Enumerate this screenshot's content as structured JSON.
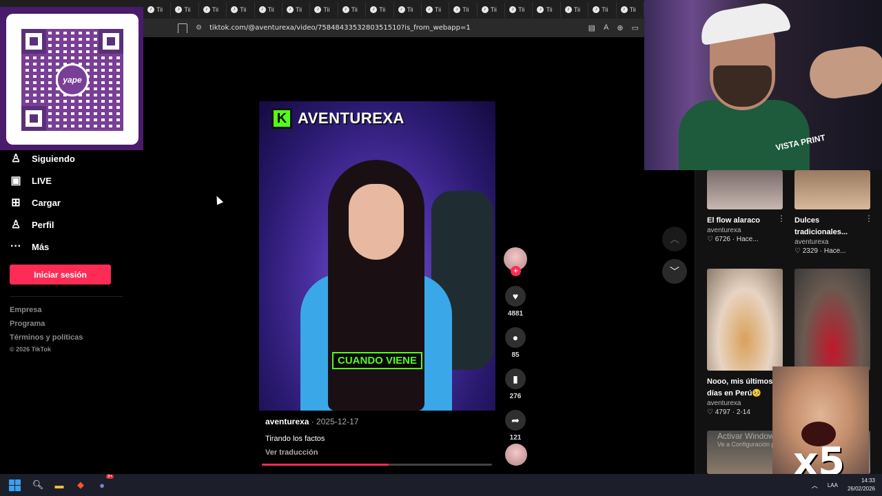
{
  "browser": {
    "url": "tiktok.com/@aventurexa/video/7584843353280351510?is_from_webapp=1",
    "tab_label": "Tii",
    "tab_count": 18
  },
  "overlay": {
    "qr_label": "yape"
  },
  "sidebar": {
    "items": [
      {
        "label": "Siguiendo",
        "icon": "following-icon"
      },
      {
        "label": "LIVE",
        "icon": "live-icon"
      },
      {
        "label": "Cargar",
        "icon": "upload-icon"
      },
      {
        "label": "Perfil",
        "icon": "profile-icon"
      },
      {
        "label": "Más",
        "icon": "more-icon"
      }
    ],
    "login_label": "Iniciar sesión",
    "footer_links": [
      "Empresa",
      "Programa",
      "Términos y políticas"
    ],
    "copyright": "© 2026 TikTok"
  },
  "video": {
    "brand_letter": "K",
    "brand_name": "AVENTUREXA",
    "caption": "CUANDO VIENE",
    "author": "aventurexa",
    "date": "2025-12-17",
    "separator": " · ",
    "description": "Tirando los factos",
    "translate": "Ver traducción",
    "progress": 0.55
  },
  "actions": {
    "likes": "4881",
    "comments": "85",
    "saves": "276",
    "shares": "121",
    "follow": "+"
  },
  "recommended": [
    {
      "title": "El flow alaraco",
      "author": "aventurexa",
      "likes": "6726",
      "time": "Hace..."
    },
    {
      "title": "Dulces tradicionales...",
      "author": "aventurexa",
      "likes": "2329",
      "time": "Hace..."
    },
    {
      "title": "Nooo, mis últimos días en Perú🥺",
      "author": "aventurexa",
      "likes": "4797",
      "time": "2-14"
    }
  ],
  "overlays": {
    "webcam_jersey": "VISTA PRINT",
    "multiplier": "x5",
    "activate_windows": "Activar Windows",
    "activate_sub": "Ve a Configuración p"
  },
  "taskbar": {
    "lang": "LAA",
    "time": "14:33",
    "date": "26/02/2026",
    "discord_badge": "9+"
  }
}
